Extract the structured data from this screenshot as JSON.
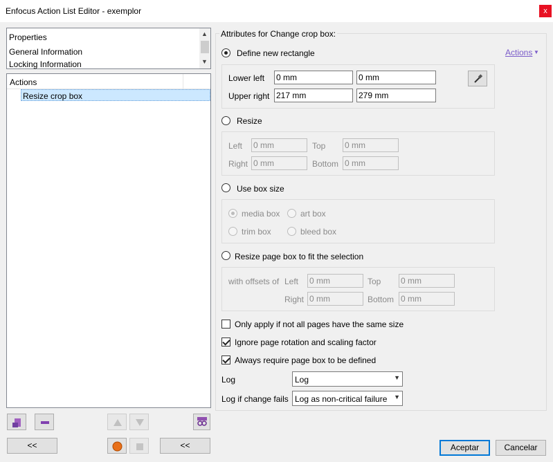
{
  "window": {
    "title": "Enfocus Action List Editor - exemplor",
    "close_glyph": "x"
  },
  "left": {
    "properties_list": [
      "Properties",
      "General Information",
      "Locking Information"
    ],
    "actions_header": "Actions",
    "actions": [
      "Resize crop box"
    ],
    "footer_buttons": {
      "collapse_left": "<<",
      "collapse_right": "<<"
    }
  },
  "right": {
    "group_title": "Attributes for Change crop box:",
    "actions_link": "Actions",
    "define_new_rectangle": {
      "label": "Define new rectangle",
      "lower_left_label": "Lower left",
      "upper_right_label": "Upper right",
      "lower_left_x": "0 mm",
      "lower_left_y": "0 mm",
      "upper_right_x": "217 mm",
      "upper_right_y": "279 mm"
    },
    "resize": {
      "label": "Resize",
      "left_label": "Left",
      "top_label": "Top",
      "right_label": "Right",
      "bottom_label": "Bottom",
      "left": "0 mm",
      "top": "0 mm",
      "right": "0 mm",
      "bottom": "0 mm"
    },
    "use_box_size": {
      "label": "Use box size",
      "options": [
        "media box",
        "art box",
        "trim box",
        "bleed box"
      ],
      "selected": "media box"
    },
    "fit_selection": {
      "label": "Resize page box to fit the selection",
      "offsets_label": "with offsets of",
      "left_label": "Left",
      "top_label": "Top",
      "right_label": "Right",
      "bottom_label": "Bottom",
      "left": "0 mm",
      "top": "0 mm",
      "right": "0 mm",
      "bottom": "0 mm"
    },
    "checkboxes": [
      {
        "label": "Only apply if not all pages have the same size",
        "checked": false
      },
      {
        "label": "Ignore page rotation and scaling factor",
        "checked": true
      },
      {
        "label": "Always require page box to be defined",
        "checked": true
      }
    ],
    "log_label": "Log",
    "log_value": "Log",
    "log_fail_label": "Log if change fails",
    "log_fail_value": "Log as non-critical failure"
  },
  "dialog_buttons": {
    "ok": "Aceptar",
    "cancel": "Cancelar"
  },
  "colors": {
    "accent": "#0078d7",
    "link": "#7a5bc9",
    "selection": "#cce8ff",
    "close": "#e81123"
  }
}
